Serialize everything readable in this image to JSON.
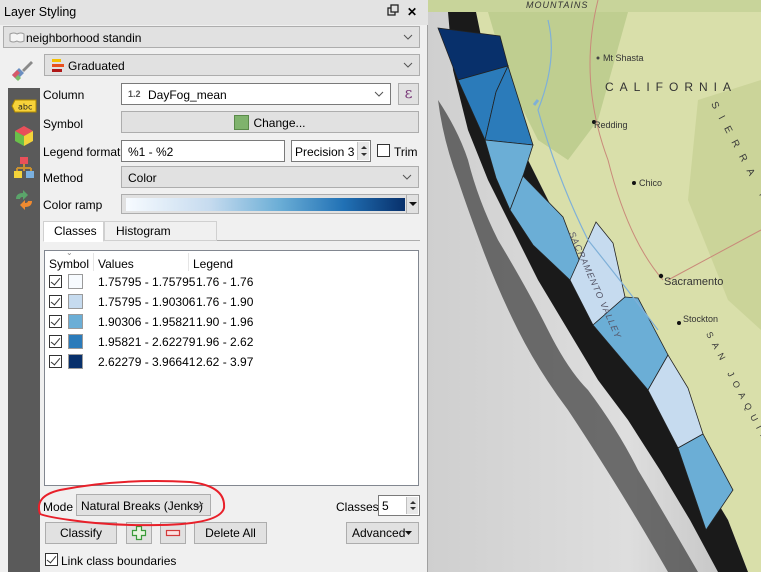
{
  "panel": {
    "title": "Layer Styling",
    "layer_name": "neighborhood standin",
    "renderer": "Graduated",
    "column_label": "Column",
    "column_type_badge": "1.2",
    "column_value": "DayFog_mean",
    "expression_button": "ε",
    "symbol_label": "Symbol",
    "symbol_button": "Change...",
    "symbol_color": "#7fb36d",
    "legend_format_label": "Legend format",
    "legend_format_value": "%1 - %2",
    "precision_value": "Precision 3",
    "trim_label": "Trim",
    "trim_checked": false,
    "method_label": "Method",
    "method_value": "Color",
    "color_ramp_label": "Color ramp",
    "tabs": [
      {
        "label": "Classes",
        "active": true
      },
      {
        "label": "Histogram",
        "active": false
      }
    ],
    "table_headers": {
      "symbol": "Symbol",
      "values": "Values",
      "legend": "Legend"
    },
    "classes": [
      {
        "checked": true,
        "color": "#f7fbff",
        "values": "1.75795 - 1.75795",
        "legend": "1.76 - 1.76"
      },
      {
        "checked": true,
        "color": "#c6dbef",
        "values": "1.75795 - 1.90306",
        "legend": "1.76 - 1.90"
      },
      {
        "checked": true,
        "color": "#6baed6",
        "values": "1.90306 - 1.95821",
        "legend": "1.90 - 1.96"
      },
      {
        "checked": true,
        "color": "#2b7bba",
        "values": "1.95821 - 2.62279",
        "legend": "1.96 - 2.62"
      },
      {
        "checked": true,
        "color": "#08306b",
        "values": "2.62279 - 3.96641",
        "legend": "2.62 - 3.97"
      }
    ],
    "mode_label": "Mode",
    "mode_value": "Natural Breaks (Jenks)",
    "classes_label": "Classes",
    "classes_count": "5",
    "classify_button": "Classify",
    "add_class_icon": "plus-icon",
    "remove_class_icon": "minus-icon",
    "delete_all_button": "Delete All",
    "advanced_button": "Advanced",
    "link_boundaries_label": "Link class boundaries",
    "link_boundaries_checked": true,
    "annotation_color": "#e8202a"
  },
  "sidebar_icons": [
    "symbology-icon",
    "labels-icon",
    "3d-view-icon",
    "diagrams-icon",
    "history-icon"
  ],
  "map": {
    "labels": [
      "MOUNTAINS",
      "Mt Shasta",
      "CALIFORNIA",
      "Redding",
      "Chico",
      "SACRAMENTO VALLEY",
      "Sacramento",
      "Stockton",
      "SIERRA NEVADA",
      "SAN JOAQUIN"
    ]
  }
}
